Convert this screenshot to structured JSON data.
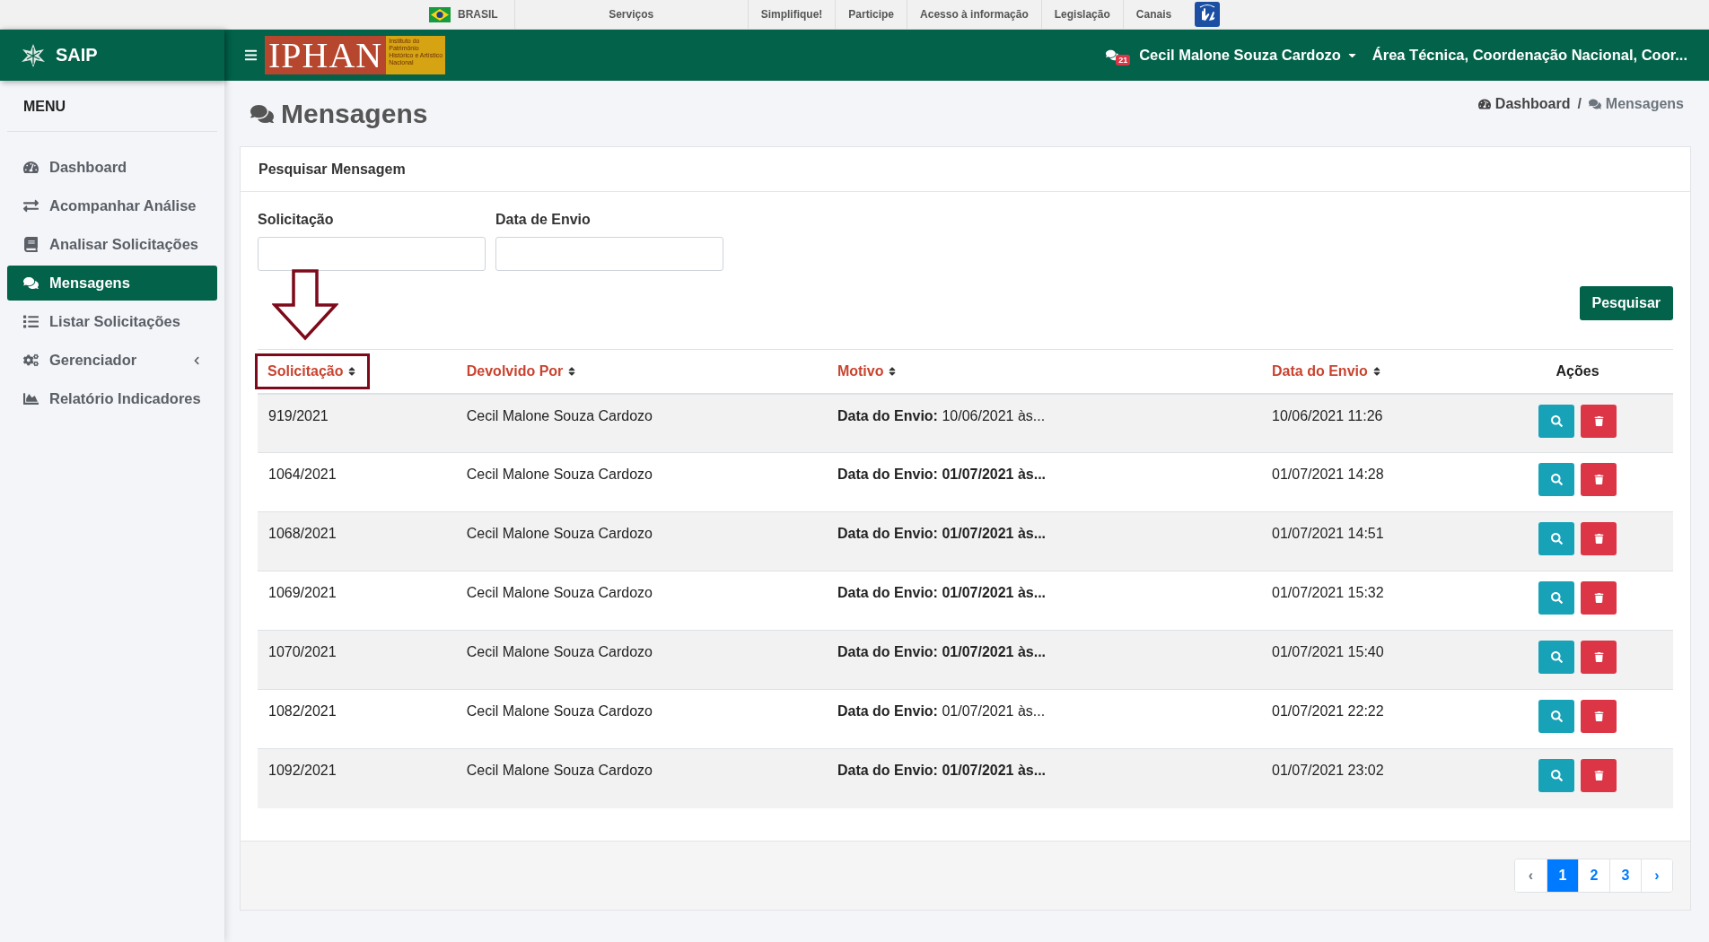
{
  "gov_bar": {
    "country": "BRASIL",
    "links": [
      "Serviços",
      "Simplifique!",
      "Participe",
      "Acesso à informação",
      "Legislação",
      "Canais"
    ]
  },
  "app": {
    "name": "SAIP"
  },
  "header": {
    "logo_text": "IPHAN",
    "logo_subtitle": "Instituto do Patrimônio Histórico e Artístico Nacional",
    "notifications": "21",
    "user": "Cecil Malone Souza Cardozo",
    "unit": "Área Técnica, Coordenação Nacional, Coor..."
  },
  "sidebar": {
    "title": "MENU",
    "items": [
      {
        "label": "Dashboard",
        "kind": "link",
        "selected": false
      },
      {
        "label": "Acompanhar Análise",
        "kind": "link",
        "selected": false
      },
      {
        "label": "Analisar Solicitações",
        "kind": "link",
        "selected": false
      },
      {
        "label": "Mensagens",
        "kind": "link",
        "selected": true
      },
      {
        "label": "Listar Solicitações",
        "kind": "link",
        "selected": false
      },
      {
        "label": "Gerenciador",
        "kind": "group",
        "selected": false
      },
      {
        "label": "Relatório Indicadores",
        "kind": "link",
        "selected": false
      }
    ]
  },
  "page": {
    "title": "Mensagens",
    "breadcrumb_separator": "/",
    "breadcrumb": [
      {
        "label": "Dashboard"
      },
      {
        "label": "Mensagens"
      }
    ]
  },
  "search_panel": {
    "title": "Pesquisar Mensagem",
    "fields": [
      {
        "label": "Solicitação"
      },
      {
        "label": "Data de Envio"
      }
    ],
    "button": "Pesquisar"
  },
  "table": {
    "columns": [
      {
        "label": "Solicitação",
        "sortable": true,
        "highlighted": true
      },
      {
        "label": "Devolvido Por",
        "sortable": true,
        "highlighted": false
      },
      {
        "label": "Motivo",
        "sortable": true,
        "highlighted": false
      },
      {
        "label": "Data do Envio",
        "sortable": true,
        "highlighted": false
      },
      {
        "label": "Ações",
        "sortable": false,
        "highlighted": false
      }
    ],
    "rows": [
      {
        "solicitacao": "919/2021",
        "devolvido_por": "Cecil Malone Souza Cardozo",
        "motivo": {
          "text": "**Data do Envio:** 10/06/2021 às...",
          "bold": false
        },
        "data_envio": "10/06/2021 11:26"
      },
      {
        "solicitacao": "1064/2021",
        "devolvido_por": "Cecil Malone Souza Cardozo",
        "motivo": {
          "text": "Data do Envio: 01/07/2021 às...",
          "bold": true
        },
        "data_envio": "01/07/2021 14:28"
      },
      {
        "solicitacao": "1068/2021",
        "devolvido_por": "Cecil Malone Souza Cardozo",
        "motivo": {
          "text": "Data do Envio: 01/07/2021 às...",
          "bold": true
        },
        "data_envio": "01/07/2021 14:51"
      },
      {
        "solicitacao": "1069/2021",
        "devolvido_por": "Cecil Malone Souza Cardozo",
        "motivo": {
          "text": "Data do Envio: 01/07/2021 às...",
          "bold": true
        },
        "data_envio": "01/07/2021 15:32"
      },
      {
        "solicitacao": "1070/2021",
        "devolvido_por": "Cecil Malone Souza Cardozo",
        "motivo": {
          "text": "Data do Envio: 01/07/2021 às...",
          "bold": true
        },
        "data_envio": "01/07/2021 15:40"
      },
      {
        "solicitacao": "1082/2021",
        "devolvido_por": "Cecil Malone Souza Cardozo",
        "motivo": {
          "text": "**Data do Envio:** 01/07/2021 às...",
          "bold": false
        },
        "data_envio": "01/07/2021 22:22"
      },
      {
        "solicitacao": "1092/2021",
        "devolvido_por": "Cecil Malone Souza Cardozo",
        "motivo": {
          "text": "Data do Envio: 01/07/2021 às...",
          "bold": true
        },
        "data_envio": "01/07/2021 23:02"
      }
    ]
  },
  "pagination": {
    "prev": "‹",
    "next": "›",
    "pages": [
      {
        "label": "1",
        "selected": true
      },
      {
        "label": "2",
        "selected": false
      },
      {
        "label": "3",
        "selected": false
      }
    ]
  }
}
